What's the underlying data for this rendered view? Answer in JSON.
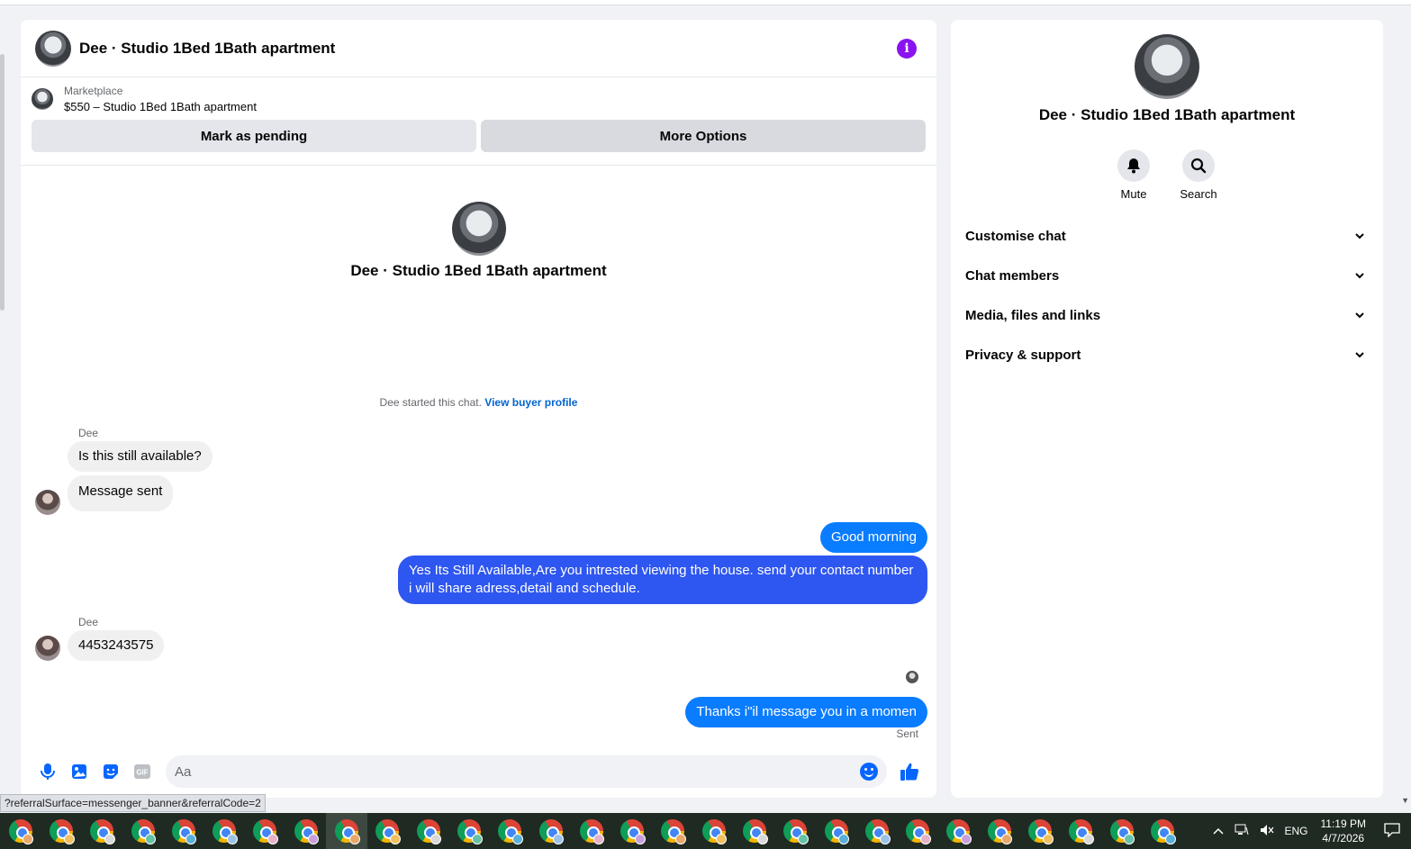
{
  "chat": {
    "title": "Dee · Studio 1Bed 1Bath apartment",
    "marketplace_label": "Marketplace",
    "listing": "$550 – Studio 1Bed 1Bath apartment",
    "mark_pending": "Mark as pending",
    "more_options": "More Options",
    "intro_name": "Dee · Studio 1Bed 1Bath apartment",
    "started_text": "Dee started this chat.",
    "view_profile": "View buyer profile",
    "messages": [
      {
        "sender": "Dee",
        "text": "Is this still available?",
        "direction": "in"
      },
      {
        "text": "Message sent",
        "direction": "in"
      },
      {
        "text": "Good morning",
        "direction": "out"
      },
      {
        "text": "Yes Its Still Available,Are you intrested viewing the house. send your contact number i will share adress,detail and schedule.",
        "direction": "out"
      },
      {
        "sender": "Dee",
        "text": "4453243575",
        "direction": "in"
      },
      {
        "text": "Thanks i\"il message you in a momen",
        "direction": "out"
      }
    ],
    "sent_status": "Sent",
    "composer_placeholder": "Aa"
  },
  "side": {
    "name": "Dee · Studio 1Bed 1Bath apartment",
    "actions": [
      {
        "label": "Mute",
        "icon": "bell-icon"
      },
      {
        "label": "Search",
        "icon": "search-icon"
      }
    ],
    "sections": [
      "Customise chat",
      "Chat members",
      "Media, files and links",
      "Privacy & support"
    ]
  },
  "status_url": "?referralSurface=messenger_banner&referralCode=2",
  "taskbar": {
    "app_count": 29,
    "active_index": 8,
    "language": "ENG",
    "time": "11:19 PM",
    "date": "4/7/2026"
  },
  "colors": {
    "accent": "#0866ff",
    "outgoing_bubble": "#0a7cff",
    "outgoing_bubble_alt": "#2e56f0",
    "info": "#8a12f0"
  }
}
